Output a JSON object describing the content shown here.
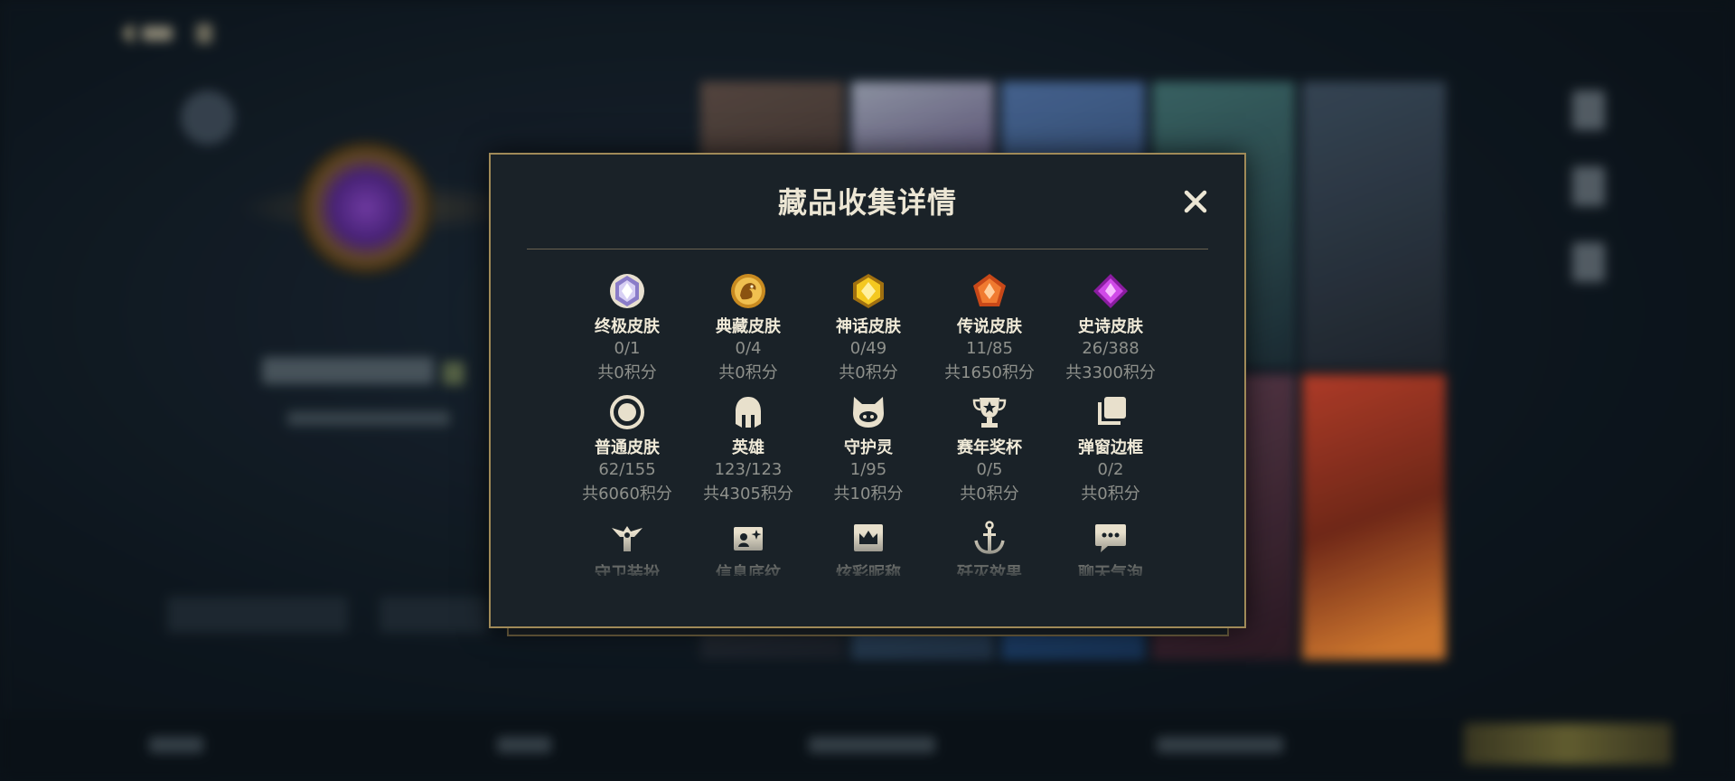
{
  "modal": {
    "title": "藏品收集详情",
    "items": [
      {
        "label": "终极皮肤",
        "count": "0/1",
        "points": "共0积分",
        "icon": "ultimate-gem-icon",
        "color": "#b9a8e8"
      },
      {
        "label": "典藏皮肤",
        "count": "0/4",
        "points": "共0积分",
        "icon": "dragon-medallion-icon",
        "color": "#e0a030"
      },
      {
        "label": "神话皮肤",
        "count": "0/49",
        "points": "共0积分",
        "icon": "mythic-gem-icon",
        "color": "#f0c020"
      },
      {
        "label": "传说皮肤",
        "count": "11/85",
        "points": "共1650积分",
        "icon": "legendary-gem-icon",
        "color": "#e8642a"
      },
      {
        "label": "史诗皮肤",
        "count": "26/388",
        "points": "共3300积分",
        "icon": "epic-gem-icon",
        "color": "#c040d8"
      },
      {
        "label": "普通皮肤",
        "count": "62/155",
        "points": "共6060积分",
        "icon": "circle-icon",
        "color": "#e4dcc6"
      },
      {
        "label": "英雄",
        "count": "123/123",
        "points": "共4305积分",
        "icon": "helmet-icon",
        "color": "#e4dcc6"
      },
      {
        "label": "守护灵",
        "count": "1/95",
        "points": "共10积分",
        "icon": "pet-icon",
        "color": "#e4dcc6"
      },
      {
        "label": "赛年奖杯",
        "count": "0/5",
        "points": "共0积分",
        "icon": "trophy-icon",
        "color": "#e4dcc6"
      },
      {
        "label": "弹窗边框",
        "count": "0/2",
        "points": "共0积分",
        "icon": "stacked-frames-icon",
        "color": "#e4dcc6"
      },
      {
        "label": "守卫装扮",
        "icon": "ward-icon",
        "color": "#e4dcc6"
      },
      {
        "label": "信息底纹",
        "icon": "card-sparkle-icon",
        "color": "#e4dcc6"
      },
      {
        "label": "炫彩昵称",
        "icon": "crown-frame-icon",
        "color": "#e4dcc6"
      },
      {
        "label": "歼灭效果",
        "icon": "anchor-icon",
        "color": "#e4dcc6"
      },
      {
        "label": "聊天气泡",
        "icon": "chat-bubble-icon",
        "color": "#e4dcc6"
      }
    ]
  },
  "colors": {
    "modal_border": "#a08a58",
    "modal_bg": "#1a2228",
    "muted_text": "#8f918c"
  }
}
